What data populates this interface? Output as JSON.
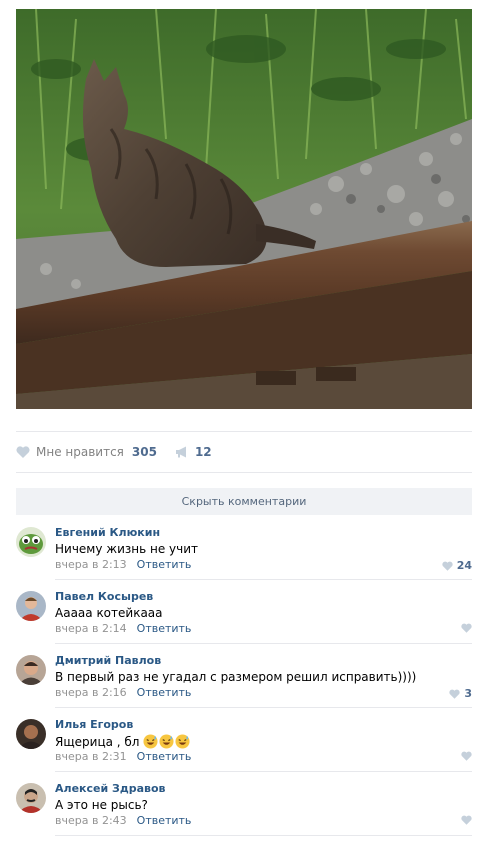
{
  "post": {
    "photo_alt": "",
    "like_label": "Мне нравится",
    "like_count": "305",
    "repost_count": "12"
  },
  "hide_comments_label": "Скрыть комментарии",
  "comments": [
    {
      "name": "Евгений Клюкин",
      "text": "Ничему жизнь не учит",
      "time": "вчера в 2:13",
      "reply": "Ответить",
      "likes": "24"
    },
    {
      "name": "Павел Косырев",
      "text": "Ааааа котейкааа",
      "time": "вчера в 2:14",
      "reply": "Ответить",
      "likes": ""
    },
    {
      "name": "Дмитрий Павлов",
      "text": "В первый раз не угадал с размером решил исправить))))",
      "time": "вчера в 2:16",
      "reply": "Ответить",
      "likes": "3"
    },
    {
      "name": "Илья Егоров",
      "text": "Ящерица , бл",
      "time": "вчера в 2:31",
      "reply": "Ответить",
      "likes": ""
    },
    {
      "name": "Алексей Здравов",
      "text": "А это не рысь?",
      "time": "вчера в 2:43",
      "reply": "Ответить",
      "likes": ""
    }
  ],
  "colors": {
    "link": "#2a5885",
    "muted": "#939393",
    "heart": "#c5d0db",
    "bar": "#f0f2f5"
  }
}
